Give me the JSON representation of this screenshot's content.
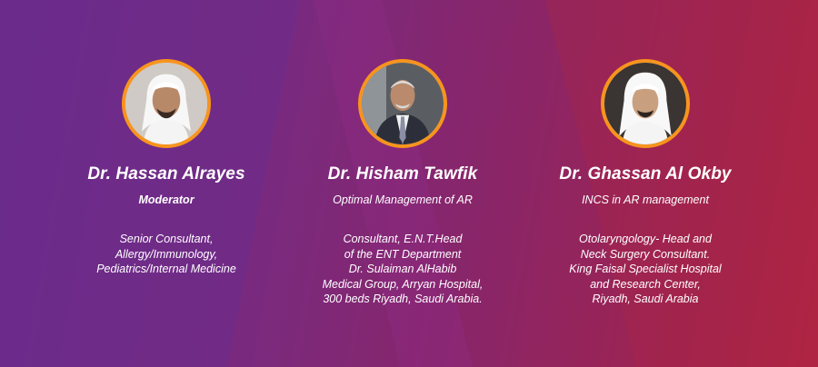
{
  "colors": {
    "accent_ring": "#f7941d",
    "background_left": "#6a2a8a",
    "background_right": "#b3243f"
  },
  "speakers": [
    {
      "name": "Dr. Hassan Alrayes",
      "role": "Moderator",
      "bio": [
        "Senior Consultant,",
        "Allergy/Immunology,",
        "Pediatrics/Internal Medicine"
      ]
    },
    {
      "name": "Dr. Hisham Tawfik",
      "role": "Optimal Management of AR",
      "bio": [
        "Consultant, E.N.T.Head",
        "of the ENT Department",
        "Dr. Sulaiman AlHabib",
        "Medical Group,  Arryan Hospital,",
        "300 beds Riyadh, Saudi Arabia."
      ]
    },
    {
      "name": "Dr. Ghassan Al Okby",
      "role": "INCS in AR management",
      "bio": [
        "Otolaryngology- Head and",
        "Neck Surgery Consultant.",
        "King Faisal Specialist Hospital",
        "and Research Center,",
        "Riyadh, Saudi Arabia"
      ]
    }
  ]
}
